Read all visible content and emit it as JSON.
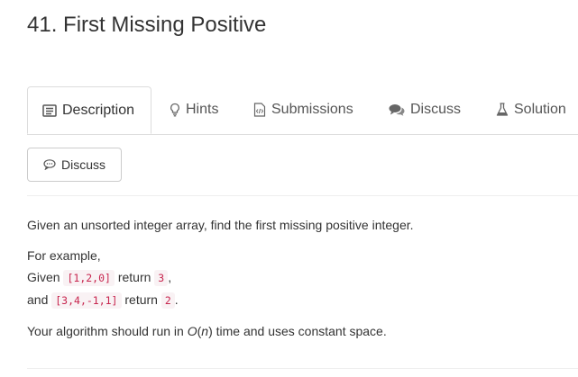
{
  "problem": {
    "title": "41. First Missing Positive"
  },
  "tabs": [
    {
      "label": "Description",
      "icon": "description-icon",
      "active": true
    },
    {
      "label": "Hints",
      "icon": "lightbulb-icon"
    },
    {
      "label": "Submissions",
      "icon": "code-file-icon"
    },
    {
      "label": "Discuss",
      "icon": "comments-icon"
    },
    {
      "label": "Solution",
      "icon": "flask-icon"
    }
  ],
  "discuss_button": {
    "label": "Discuss",
    "icon": "comment-icon"
  },
  "description": {
    "intro": "Given an unsorted integer array, find the first missing positive integer.",
    "example_heading": "For example,",
    "ex1_prefix": "Given",
    "ex1_input": "[1,2,0]",
    "ex1_mid": "return",
    "ex1_output": "3",
    "ex1_suffix": ",",
    "ex2_prefix": "and",
    "ex2_input": "[3,4,-1,1]",
    "ex2_mid": "return",
    "ex2_output": "2",
    "ex2_suffix": ".",
    "constraint_prefix": "Your algorithm should run in",
    "complexity_O": "O",
    "complexity_n": "n",
    "constraint_suffix": "time and uses constant space."
  }
}
